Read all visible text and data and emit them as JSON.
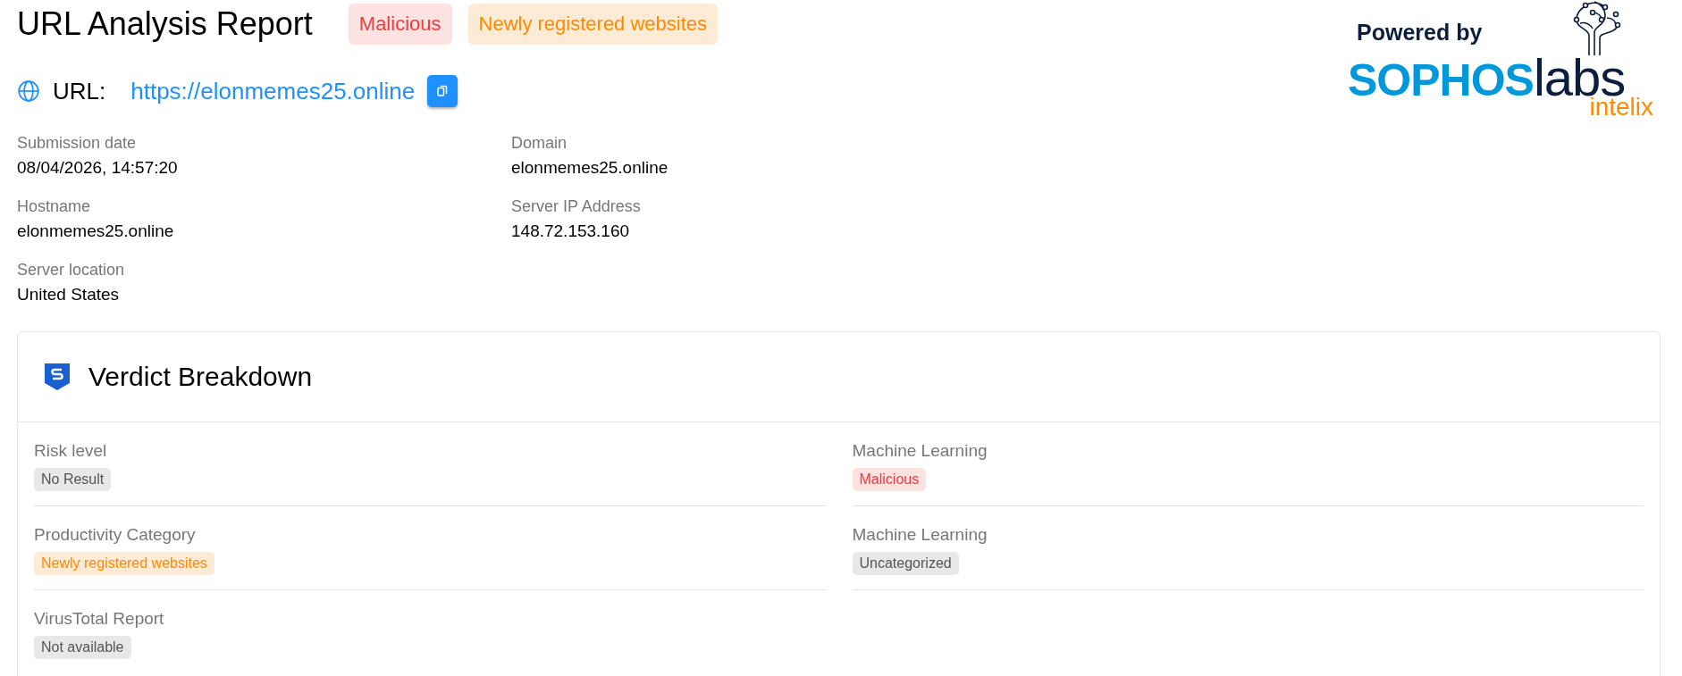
{
  "header": {
    "title": "URL Analysis Report",
    "badges": [
      {
        "text": "Malicious",
        "kind": "danger"
      },
      {
        "text": "Newly registered websites",
        "kind": "warning"
      }
    ]
  },
  "url": {
    "label": "URL:",
    "link": "https://elonmemes25.online"
  },
  "logo": {
    "powered": "Powered by",
    "brand": "SOPHOS",
    "labs": "labs",
    "product": "intelix"
  },
  "details": [
    {
      "label": "Submission date",
      "value": "08/04/2026, 14:57:20"
    },
    {
      "label": "Domain",
      "value": "elonmemes25.online"
    },
    {
      "label": "Hostname",
      "value": "elonmemes25.online"
    },
    {
      "label": "Server IP Address",
      "value": "148.72.153.160"
    },
    {
      "label": "Server location",
      "value": "United States"
    }
  ],
  "verdict": {
    "title": "Verdict Breakdown",
    "items": [
      {
        "label": "Risk level",
        "value": "No Result",
        "kind": "neutral"
      },
      {
        "label": "Machine Learning",
        "value": "Malicious",
        "kind": "danger"
      },
      {
        "label": "Productivity Category",
        "value": "Newly registered websites",
        "kind": "warning"
      },
      {
        "label": "Machine Learning",
        "value": "Uncategorized",
        "kind": "neutral"
      },
      {
        "label": "VirusTotal Report",
        "value": "Not available",
        "kind": "neutral"
      }
    ]
  }
}
